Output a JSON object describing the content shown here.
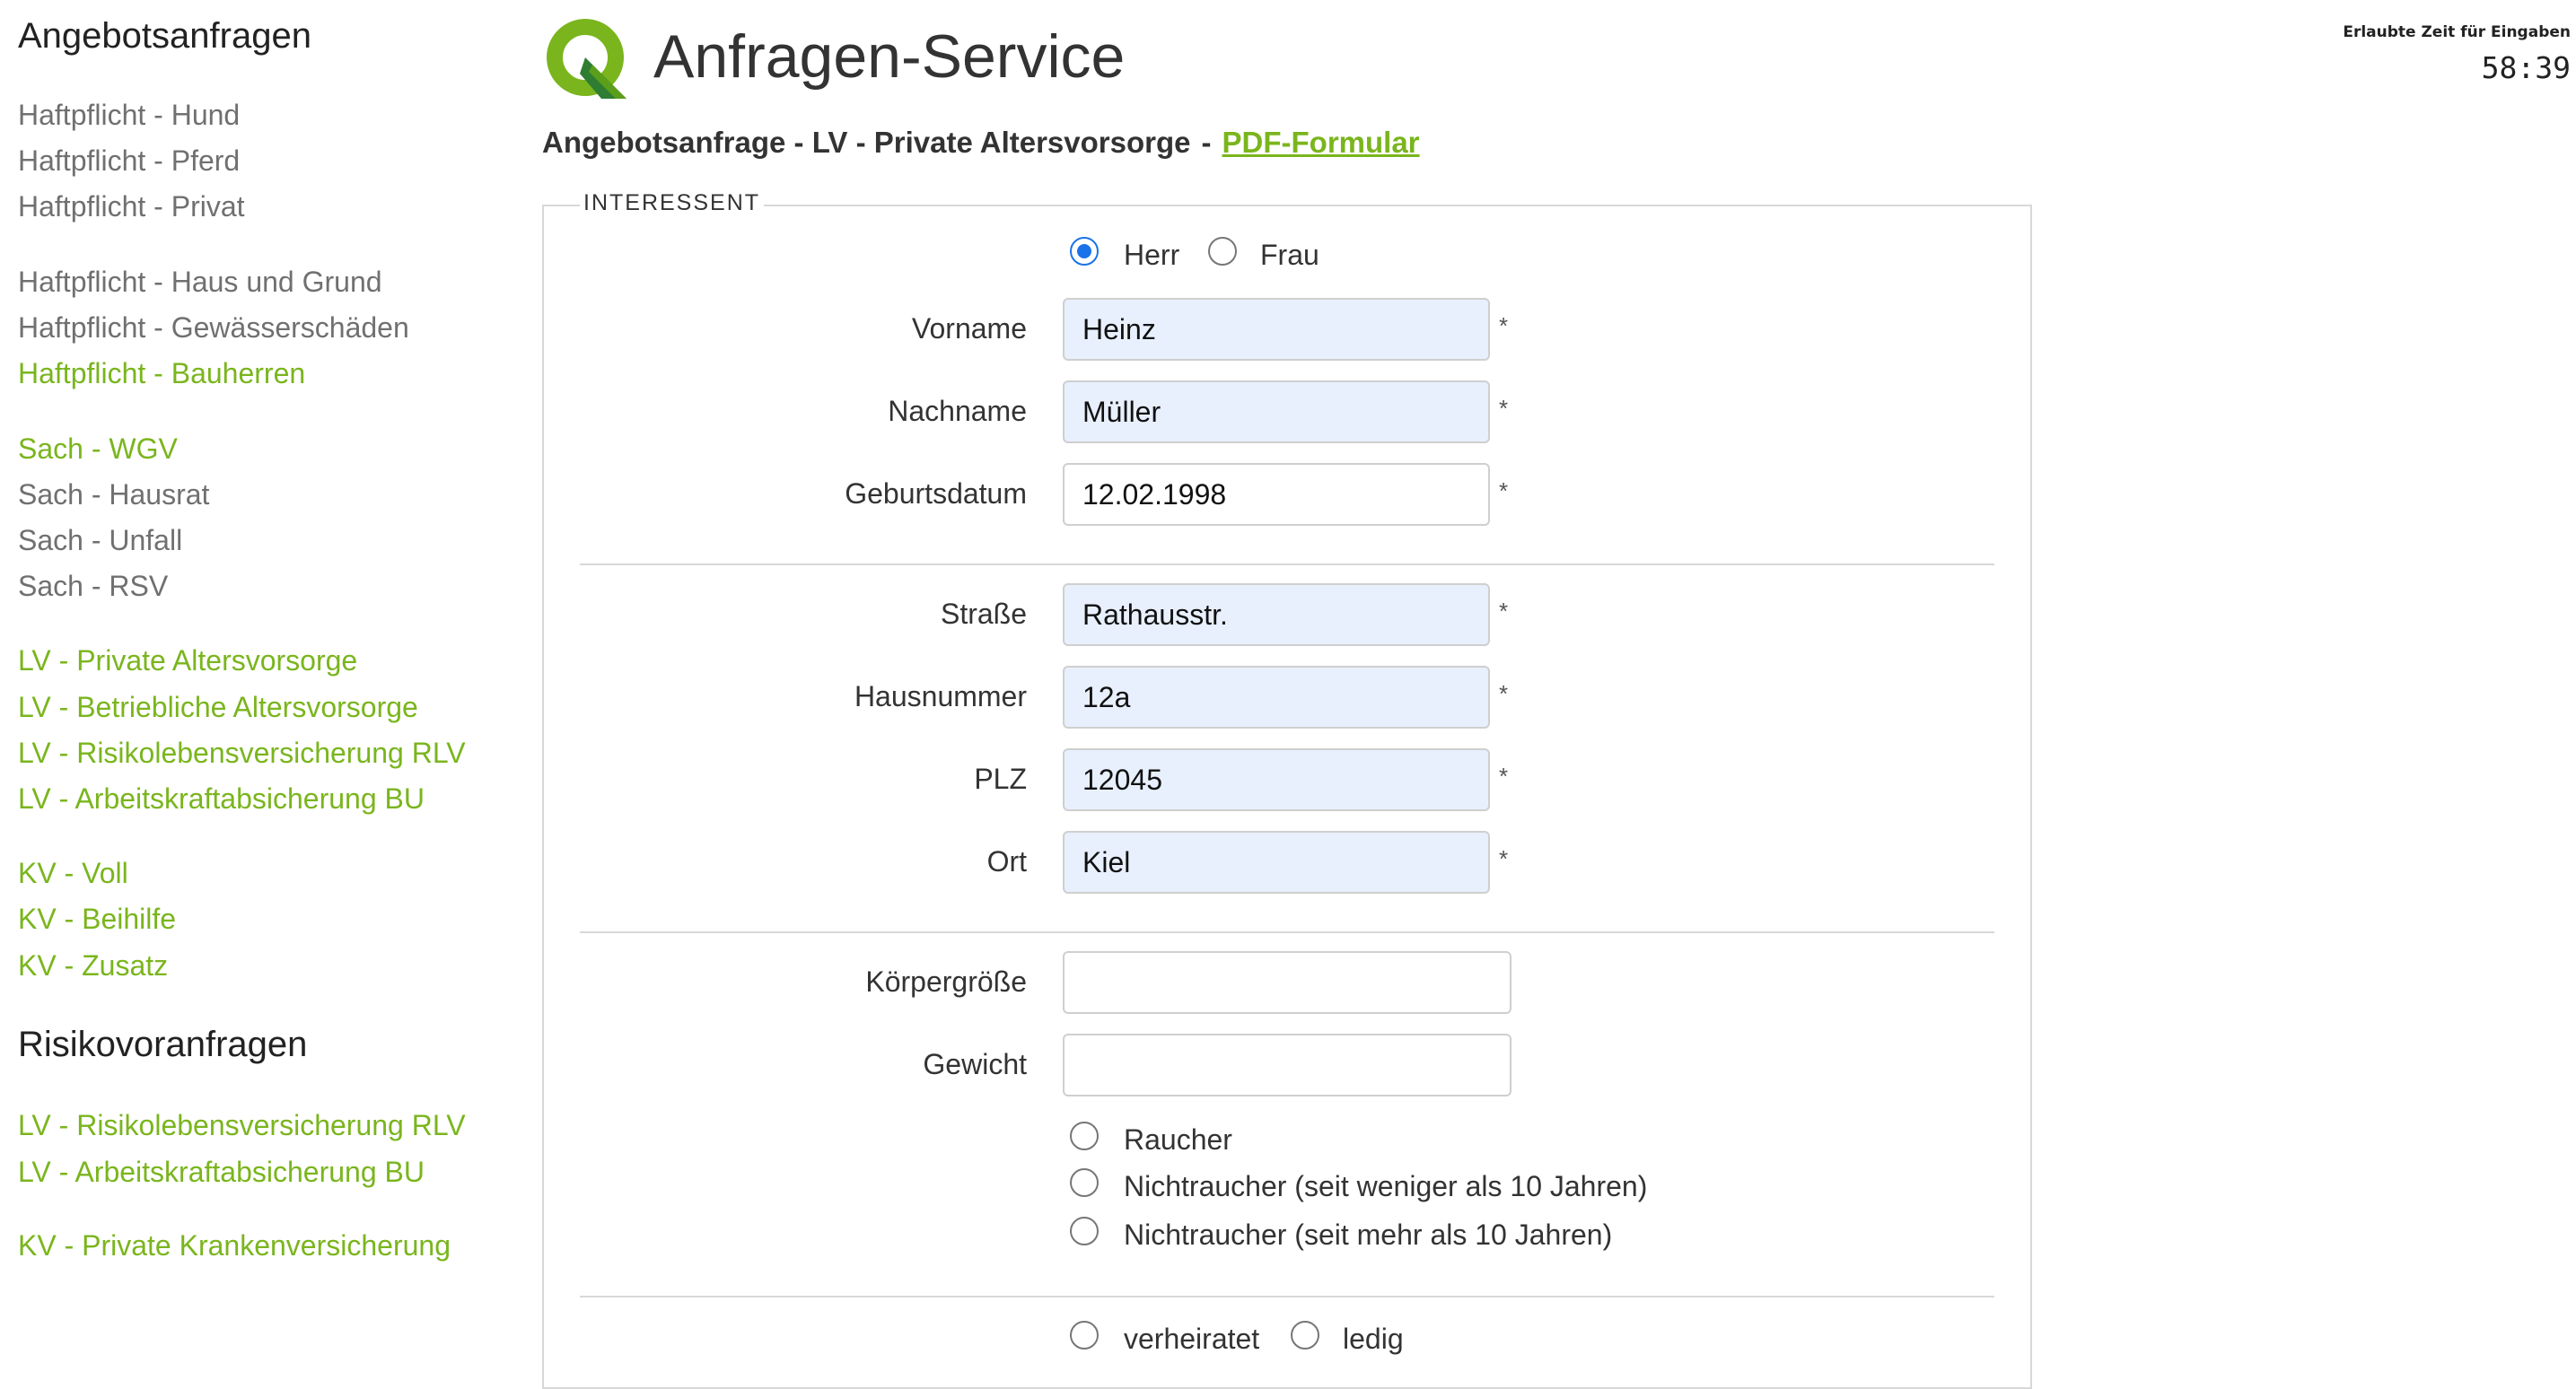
{
  "sidebar": {
    "heading_offers": "Angebotsanfragen",
    "offer_links": [
      "Haftpflicht - Hund",
      "Haftpflicht - Pferd",
      "Haftpflicht - Privat",
      "Haftpflicht - Haus und Grund",
      "Haftpflicht - Gewässerschäden",
      "Haftpflicht - Bauherren",
      "Sach - WGV",
      "Sach - Hausrat",
      "Sach - Unfall",
      "Sach - RSV",
      "LV - Private Altersvorsorge",
      "LV - Betriebliche Altersvorsorge",
      "LV - Risikolebensversicherung RLV",
      "LV - Arbeitskraftabsicherung BU",
      "KV - Voll",
      "KV - Beihilfe",
      "KV - Zusatz"
    ],
    "heading_risk": "Risikovoranfragen",
    "risk_links": [
      "LV - Risikolebensversicherung RLV",
      "LV - Arbeitskraftabsicherung BU",
      "KV - Private Krankenversicherung"
    ]
  },
  "header": {
    "app_title": "Anfragen-Service",
    "timer_label": "Erlaubte Zeit für Eingaben",
    "timer_value": "58:39"
  },
  "form": {
    "subtitle": "Angebotsanfrage - LV - Private Altersvorsorge",
    "separator": "-",
    "pdf_link": "PDF-Formular",
    "legend": "INTERESSENT",
    "salutation": {
      "herr": "Herr",
      "frau": "Frau",
      "selected": "Herr"
    },
    "required_mark": "*",
    "fields": {
      "vorname": {
        "label": "Vorname",
        "value": "Heinz"
      },
      "nachname": {
        "label": "Nachname",
        "value": "Müller"
      },
      "geburtsdatum": {
        "label": "Geburtsdatum",
        "value": "12.02.1998"
      },
      "strasse": {
        "label": "Straße",
        "value": "Rathausstr."
      },
      "hausnummer": {
        "label": "Hausnummer",
        "value": "12a"
      },
      "plz": {
        "label": "PLZ",
        "value": "12045"
      },
      "ort": {
        "label": "Ort",
        "value": "Kiel"
      },
      "koerpergroesse": {
        "label": "Körpergröße",
        "value": ""
      },
      "gewicht": {
        "label": "Gewicht",
        "value": ""
      }
    },
    "smoker": {
      "raucher": "Raucher",
      "nichtraucher_lt10": "Nichtraucher (seit weniger als 10 Jahren)",
      "nichtraucher_gt10": "Nichtraucher (seit mehr als 10 Jahren)"
    },
    "marital": {
      "verheiratet": "verheiratet",
      "ledig": "ledig"
    }
  },
  "colors": {
    "accent_green": "#7ab51d",
    "link_grey": "#707070",
    "autofill_bg": "#e8f0fe",
    "radio_blue": "#1a73e8"
  }
}
